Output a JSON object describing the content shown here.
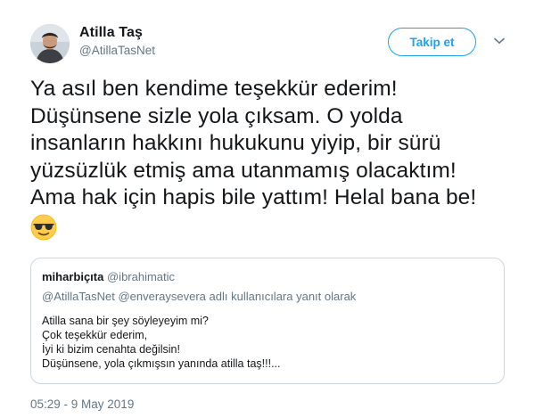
{
  "author": {
    "display_name": "Atilla Taş",
    "handle": "@AtillaTasNet",
    "avatar_icon": "user-avatar-photo"
  },
  "actions": {
    "follow_label": "Takip et",
    "more_icon": "chevron-down-icon"
  },
  "tweet": {
    "lines": [
      "Ya asıl ben kendime teşekkür ederim!",
      "Düşünsene sizle yola çıksam. O yolda",
      "insanların hakkını hukukunu yiyip, bir sürü",
      "yüzsüzlük etmiş ama utanmamış olacaktım!",
      "Ama hak için hapis bile yattım! Helal bana be!"
    ],
    "emoji": "smiling-face-with-sunglasses"
  },
  "quoted": {
    "display_name": "miharbiçıta",
    "handle": "@ibrahimatic",
    "reply_mentions": "@AtillaTasNet @enveraysevera",
    "reply_suffix": "adlı kullanıcılara yanıt olarak",
    "lines": [
      "Atilla sana bir şey söyleyeyim mi?",
      "Çok teşekkür ederim,",
      "İyi ki bizim cenahta değilsin!",
      "Düşünsene,  yola çıkmışsın yanında atilla taş!!!..."
    ]
  },
  "timestamp": "05:29 - 9 May 2019",
  "colors": {
    "accent": "#1da1f2",
    "secondary_text": "#657786",
    "primary_text": "#14171a",
    "border": "#ccd6dd"
  }
}
